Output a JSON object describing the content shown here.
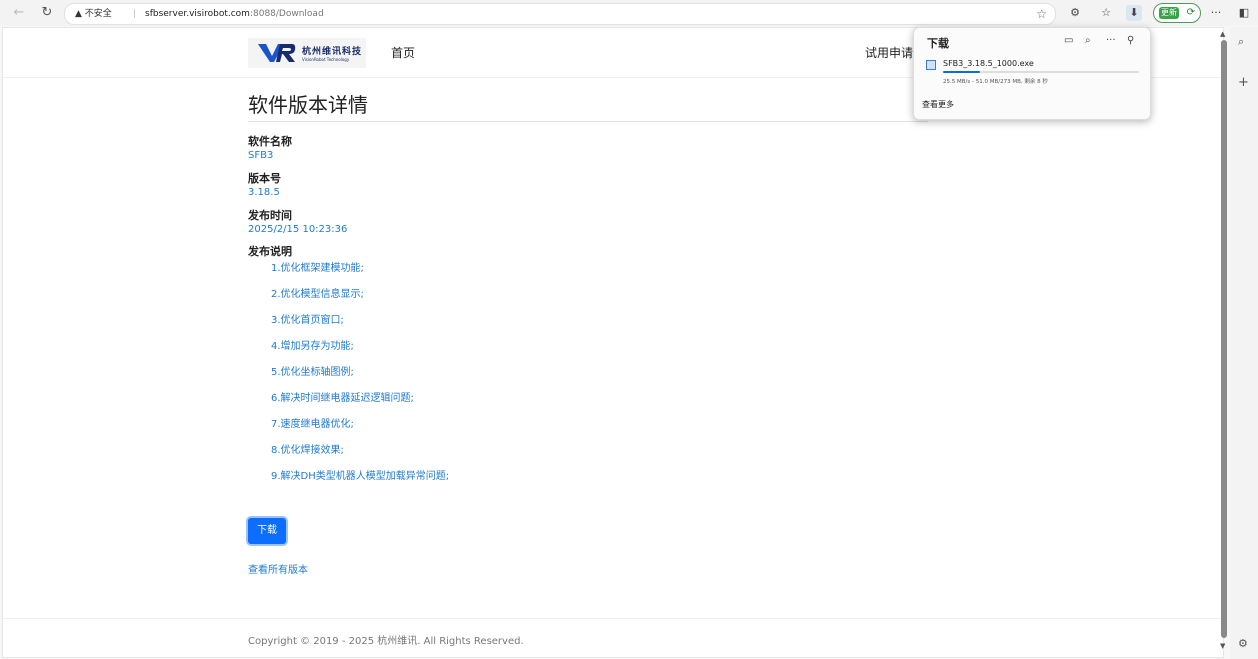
{
  "browser": {
    "address_warning": "▲ 不安全",
    "url_host": "sfbserver.visirobot.com",
    "url_rest": ":8088/Download",
    "update_label": "更新"
  },
  "header": {
    "logo_name": "杭州维讯科技",
    "logo_subtitle": "VisionRobot Technology",
    "home_link": "首页",
    "trial_link": "试用申请"
  },
  "main": {
    "title": "软件版本详情",
    "name_label": "软件名称",
    "name_value": "SFB3",
    "version_label": "版本号",
    "version_value": "3.18.5",
    "release_time_label": "发布时间",
    "release_time_value": "2025/2/15 10:23:36",
    "release_notes_label": "发布说明",
    "release_notes": [
      "1.优化框架建模功能;",
      "2.优化模型信息显示;",
      "3.优化首页窗口;",
      "4.增加另存为功能;",
      "5.优化坐标轴图例;",
      "6.解决时间继电器延迟逻辑问题;",
      "7.速度继电器优化;",
      "8.优化焊接效果;",
      "9.解决DH类型机器人模型加载异常问题;"
    ],
    "download_button": "下载",
    "all_versions_link": "查看所有版本"
  },
  "footer": {
    "copyright": "Copyright © 2019 - 2025 杭州维讯. All Rights Reserved."
  },
  "downloads_popup": {
    "title": "下载",
    "file_name": "SFB3_3.18.5_1000.exe",
    "progress_fraction": 0.19,
    "status": "25.5 MB/s - 51.0 MB/273 MB, 剩余 8 秒",
    "see_more": "查看更多"
  }
}
